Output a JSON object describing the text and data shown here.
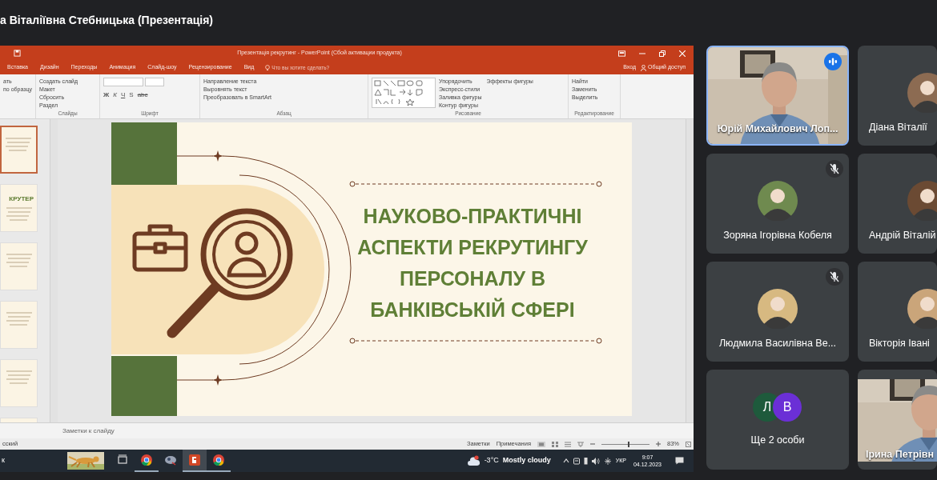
{
  "meeting": {
    "presenter_title": "а Віталіївна Стебницька (Презентація)"
  },
  "powerpoint": {
    "window_title": "Презентація рекрутинг - PowerPoint (Сбой активации продукта)",
    "tabs": [
      {
        "label": "Вставка",
        "selected": false
      },
      {
        "label": "Дизайн",
        "selected": false
      },
      {
        "label": "Переходы",
        "selected": false
      },
      {
        "label": "Анимация",
        "selected": false
      },
      {
        "label": "Слайд-шоу",
        "selected": false
      },
      {
        "label": "Рецензирование",
        "selected": false
      },
      {
        "label": "Вид",
        "selected": false
      }
    ],
    "tell_me": "Что вы хотите сделать?",
    "sign_in": "Вход",
    "share": "Общий доступ",
    "ribbon": [
      {
        "kind": "buttons",
        "items": [
          "ать",
          "по образцу"
        ]
      },
      {
        "kind": "buttons",
        "label": "Слайды",
        "items": [
          "Создать слайд",
          "Макет",
          "Сбросить",
          "Раздел"
        ]
      },
      {
        "kind": "font",
        "label": "Шрифт",
        "items": [
          "Ж",
          "К",
          "Ч",
          "S",
          "abc"
        ]
      },
      {
        "kind": "buttons",
        "label": "Абзац",
        "items": [
          "Направление текста",
          "Выровнять текст",
          "Преобразовать в SmartArt"
        ]
      },
      {
        "kind": "shapes",
        "label": "Рисование",
        "items": [
          "Упорядочить",
          "Экспресс-стили",
          "Заливка фигуры",
          "Контур фигуры",
          "Эффекты фигуры"
        ]
      },
      {
        "kind": "buttons",
        "label": "Редактирование",
        "items": [
          "Найти",
          "Заменить",
          "Выделить"
        ]
      }
    ],
    "thumbnails": [
      {
        "selected": true
      },
      {
        "selected": false,
        "title": "КРУТЕР"
      },
      {
        "selected": false
      },
      {
        "selected": false
      },
      {
        "selected": false
      },
      {
        "selected": false
      }
    ],
    "slide": {
      "title": "НАУКОВО-ПРАКТИЧНІ\nАСПЕКТИ РЕКРУТИНГУ\nПЕРСОНАЛУ В\nБАНКІВСЬКІЙ СФЕРІ"
    },
    "notes_placeholder": "Заметки к слайду",
    "status_bar": {
      "language": "сский",
      "notes": "Заметки",
      "comments": "Примечания",
      "zoom": "83%",
      "zoom_slider": {
        "level": 0.55
      }
    }
  },
  "taskbar": {
    "search_text": "к",
    "apps": [
      {
        "kind": "task-view",
        "running": false,
        "selected": false
      },
      {
        "kind": "chrome",
        "running": true,
        "selected": false
      },
      {
        "kind": "app",
        "running": false,
        "selected": false
      },
      {
        "kind": "powerpoint",
        "running": true,
        "selected": true
      },
      {
        "kind": "chrome",
        "running": true,
        "selected": false
      }
    ],
    "weather": {
      "temperature": "-3°C",
      "condition": "Mostly cloudy"
    },
    "language": "УКР",
    "time": "9:07",
    "date": "04.12.2023"
  },
  "participants": [
    {
      "kind": "video",
      "name": "Юрій Михайлович Лоп...",
      "speaking": true,
      "muted": false
    },
    {
      "kind": "avatar",
      "name": "Діана Віталії",
      "speaking": false,
      "muted": false
    },
    {
      "kind": "avatar",
      "name": "Зоряна Ігорівна Кобеля",
      "speaking": false,
      "muted": true
    },
    {
      "kind": "avatar",
      "name": "Андрій Віталій",
      "speaking": false,
      "muted": false
    },
    {
      "kind": "avatar",
      "name": "Людмила Василівна Ве...",
      "speaking": false,
      "muted": true
    },
    {
      "kind": "avatar",
      "name": "Вікторія Івані",
      "speaking": false,
      "muted": false
    },
    {
      "kind": "overflow",
      "name": "Ще 2 особи",
      "speaking": false,
      "muted": false,
      "initials": [
        {
          "letter": "Л",
          "color": "#1e5a3c"
        },
        {
          "letter": "В",
          "color": "#6b2fd6"
        }
      ]
    },
    {
      "kind": "video",
      "name": "Ірина Петрівн",
      "speaking": false,
      "muted": false
    }
  ]
}
